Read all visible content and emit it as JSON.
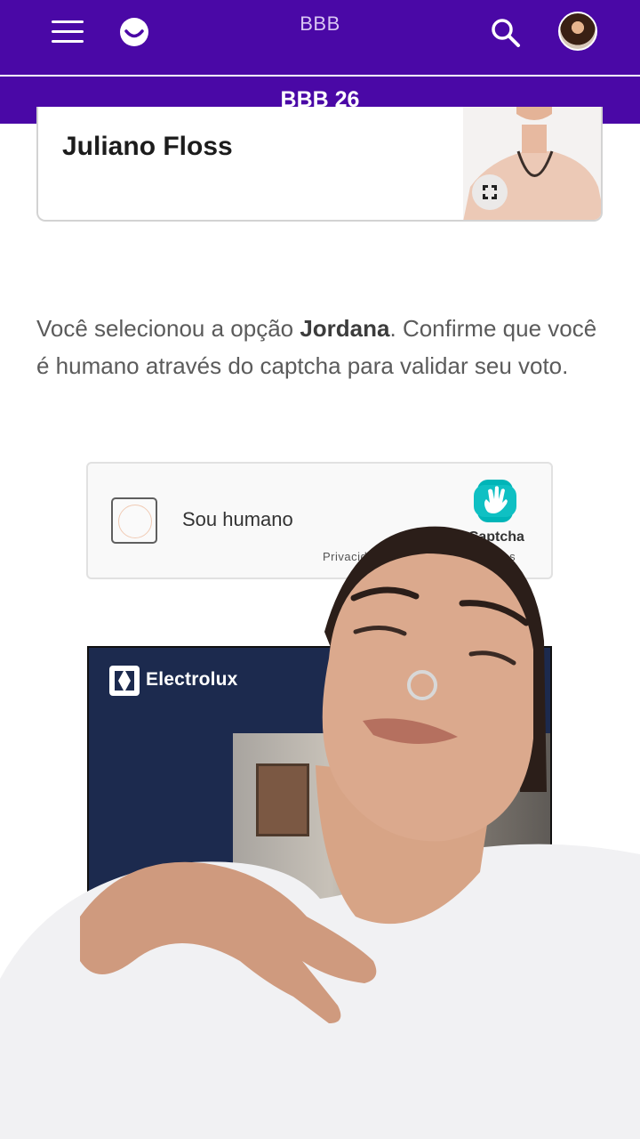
{
  "header": {
    "title": "BBB",
    "subtitle": "BBB 26",
    "icons": {
      "menu": "hamburger-icon",
      "logo": "smile-logo-icon",
      "search": "search-icon",
      "avatar": "user-avatar"
    }
  },
  "candidate_card": {
    "name": "Juliano Floss",
    "icons": {
      "expand": "expand-icon"
    }
  },
  "message": {
    "prefix": "Você selecionou a opção ",
    "selected_option": "Jordana",
    "suffix": ". Confirme que você é humano através do captcha para validar seu voto."
  },
  "captcha": {
    "checkbox_label": "Sou humano",
    "brand": "hCaptcha",
    "privacy_link": "Privacid",
    "terms_link": "dições",
    "logo_icon": "hcaptcha-hand-icon"
  },
  "ad": {
    "brand": "Electrolux",
    "logo_icon": "electrolux-logo-icon"
  },
  "colors": {
    "header_bg": "#4a08a6",
    "ad_bg": "#1c2a4e",
    "hcaptcha_accent": "#00b5b8"
  }
}
